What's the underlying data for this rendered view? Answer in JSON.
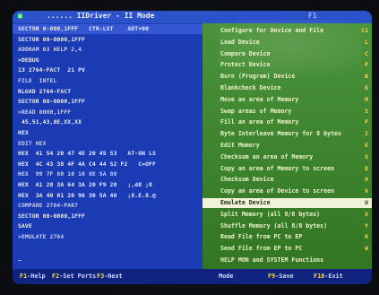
{
  "titlebar": {
    "icon": "selection-icon",
    "title": "...... IIDriver - II Mode",
    "right": "F1"
  },
  "left_pane": {
    "lines": [
      "SECTOR 0-000,1FFF   CTR-LST    ADT+00",
      "SECTOR 00-0000,1FFF",
      "ADDRAM 03 HELP 2,4",
      ">DEBUG",
      "13 2764-FACT  21 PV",
      "FILE  INTEL",
      "RLOAD 2764-FACT",
      "SECTOR 00-0000,1FFF",
      ">READ 0000,1FFF",
      " 45,51,43,8E,XX,XX",
      "HEX",
      "EDIT HEX",
      "HEX  41 54 20 47 4E 20 45 53   AT-ON LS",
      "HEX  4C 43 38 4F 4A C4 44 S2 F2   C=OFF",
      "HEX  99 7F 80 10 10 8E 5A 08",
      "HEX  A1 28 3A 64 3A 20 F9 20   ;,d8 ;8",
      "HEX  3A 40 01 20 96 30 5A 40   ;8.E.8.@",
      "COMPARE 2764-PAR7",
      "SECTOR 00-0000,1FFF",
      "SAVE",
      ">EMULATE 2764",
      "",
      "_"
    ]
  },
  "menu": {
    "items": [
      {
        "label": "Configure for Device and File",
        "key": "C1"
      },
      {
        "label": "Load Device",
        "key": "L"
      },
      {
        "label": "Compare Device",
        "key": "C"
      },
      {
        "label": "Protect Device",
        "key": "P"
      },
      {
        "label": "Burn (Program) Device",
        "key": "B"
      },
      {
        "label": "Blankcheck Device",
        "key": "K"
      },
      {
        "label": "Move an area of Memory",
        "key": "M"
      },
      {
        "label": "Swap areas of Memory",
        "key": "S"
      },
      {
        "label": "Fill an area of Memory",
        "key": "F"
      },
      {
        "label": "Byte Interleave Memory for 8 bytes",
        "key": "I"
      },
      {
        "label": "Edit Memory",
        "key": "E"
      },
      {
        "label": "Checksum an area of Memory",
        "key": "S"
      },
      {
        "label": "Copy an area of Memory to screen",
        "key": "D"
      },
      {
        "label": "Checksum Device",
        "key": "H"
      },
      {
        "label": "Copy an area of Device to screen",
        "key": "V"
      },
      {
        "label": "Emulate Device",
        "key": "U",
        "selected": true
      },
      {
        "label": "Split Memory (all 8/8 bytes)",
        "key": "X"
      },
      {
        "label": "Shuffle Memory (all 8/8 bytes)",
        "key": "Y"
      },
      {
        "label": "Read File from PC to EP",
        "key": "R"
      },
      {
        "label": "Send File from EP to PC",
        "key": "W"
      },
      {
        "label": "HELP MON and SYSTEM Functions",
        "key": ""
      }
    ]
  },
  "statusbar": {
    "keys": [
      {
        "key": "F1",
        "text": "-Help"
      },
      {
        "key": "F2",
        "text": "-Set Ports"
      },
      {
        "key": "F3",
        "text": "-Next"
      },
      {
        "key": "",
        "text": "Mode"
      },
      {
        "key": "F9",
        "text": "-Save"
      },
      {
        "key": "F10",
        "text": "-Exit"
      }
    ]
  },
  "colors": {
    "left_pane": "#1a3bb3",
    "right_pane": "#3b8a2a",
    "selected": "#f0f3d8",
    "key_accent": "#ffd84a"
  }
}
